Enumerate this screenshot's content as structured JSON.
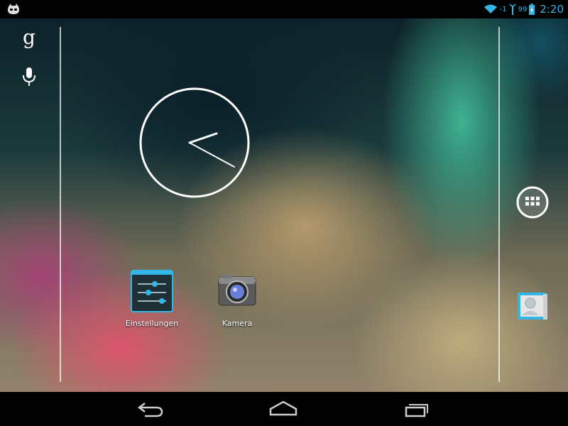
{
  "status_bar": {
    "signal_label": "-1",
    "battery_level": "99",
    "time": "2:20",
    "accent_color": "#33b5e5",
    "icons": [
      "cyanogenmod-icon",
      "wifi-icon",
      "signal-icon",
      "battery-icon"
    ]
  },
  "search": {
    "google_glyph": "g",
    "icons": [
      "google-search-icon",
      "voice-search-icon"
    ]
  },
  "clock": {
    "type": "analog",
    "hour_hand": "2",
    "minute_hand": "20"
  },
  "apps": [
    {
      "label": "Einstellungen",
      "icon": "settings-icon"
    },
    {
      "label": "Kamera",
      "icon": "camera-icon"
    }
  ],
  "dock": {
    "icons": [
      "all-apps-icon",
      "contacts-icon"
    ]
  },
  "nav": {
    "icons": [
      "back-icon",
      "home-icon",
      "recents-icon"
    ]
  }
}
